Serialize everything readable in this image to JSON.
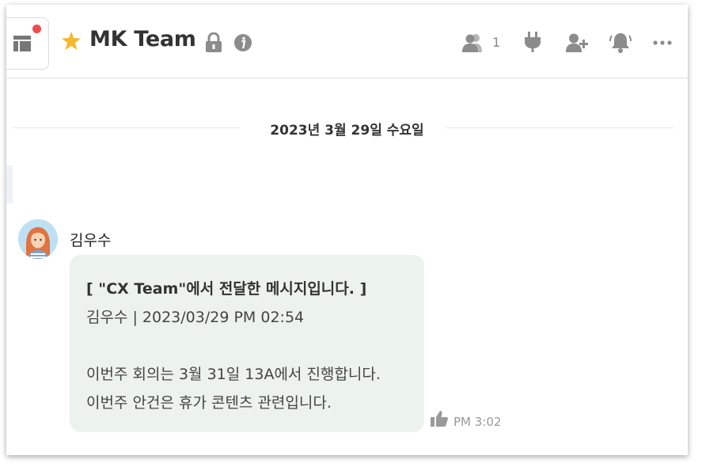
{
  "header": {
    "title": "MK Team",
    "member_count": "1",
    "icons": [
      "panel-layout-icon",
      "star-icon",
      "lock-icon",
      "info-icon",
      "members-icon",
      "plug-icon",
      "add-member-icon",
      "bell-icon",
      "more-icon"
    ]
  },
  "date_divider": "2023년 3월 29일 수요일",
  "message": {
    "sender": "김우수",
    "forward_title": "[ \"CX Team\"에서 전달한 메시지입니다. ]",
    "forward_meta": "김우수 | 2023/03/29 PM 02:54",
    "body_lines": [
      "이번주 회의는 3월 31일 13A에서 진행합니다.",
      "이번주 안건은 휴가 콘텐츠 관련입니다."
    ],
    "time": "PM 3:02"
  },
  "colors": {
    "bubble": "#ecf3ee",
    "star": "#f5b82e",
    "notification_dot": "#f04b4b",
    "icon_gray": "#8c8c8c"
  }
}
